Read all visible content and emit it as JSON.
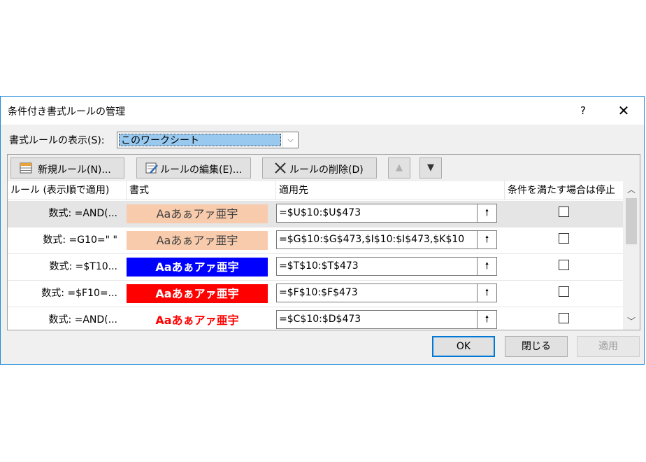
{
  "window": {
    "title": "条件付き書式ルールの管理",
    "help": "?",
    "close": "✕"
  },
  "show_rules": {
    "label": "書式ルールの表示(S):",
    "value": "このワークシート",
    "arrow": "⌵"
  },
  "toolbar": {
    "new_rule": "新規ルール(N)...",
    "edit_rule": "ルールの編集(E)...",
    "delete_rule": "ルールの削除(D)",
    "move_up": "▲",
    "move_down": "▼"
  },
  "columns": {
    "rule": "ルール (表示順で適用)",
    "format": "書式",
    "applies_to": "適用先",
    "stop_if_true": "条件を満たす場合は停止"
  },
  "rows": [
    {
      "rule": "数式: =AND(...",
      "preview": "Aaあぁアァ亜宇",
      "preview_bg": "#f8cbad",
      "preview_color": "#404040",
      "applies_to": "=$U$10:$U$473"
    },
    {
      "rule": "数式: =G10=\" \"",
      "preview": "Aaあぁアァ亜宇",
      "preview_bg": "#f8cbad",
      "preview_color": "#404040",
      "applies_to": "=$G$10:$G$473,$I$10:$I$473,$K$10"
    },
    {
      "rule": "数式: =$T10...",
      "preview": "Aaあぁアァ亜宇",
      "preview_bg": "#0000ff",
      "preview_color": "#ffffff",
      "applies_to": "=$T$10:$T$473"
    },
    {
      "rule": "数式: =$F10=...",
      "preview": "Aaあぁアァ亜宇",
      "preview_bg": "#ff0000",
      "preview_color": "#ffffff",
      "applies_to": "=$F$10:$F$473"
    },
    {
      "rule": "数式: =AND(...",
      "preview": "Aaあぁアァ亜宇",
      "preview_bg": "#ffffff",
      "preview_color": "#ff0000",
      "applies_to": "=$C$10:$D$473"
    }
  ],
  "buttons": {
    "ok": "OK",
    "close": "閉じる",
    "apply": "適用"
  },
  "colors": {
    "accent": "#0078d7",
    "selection": "#99c9ef"
  }
}
